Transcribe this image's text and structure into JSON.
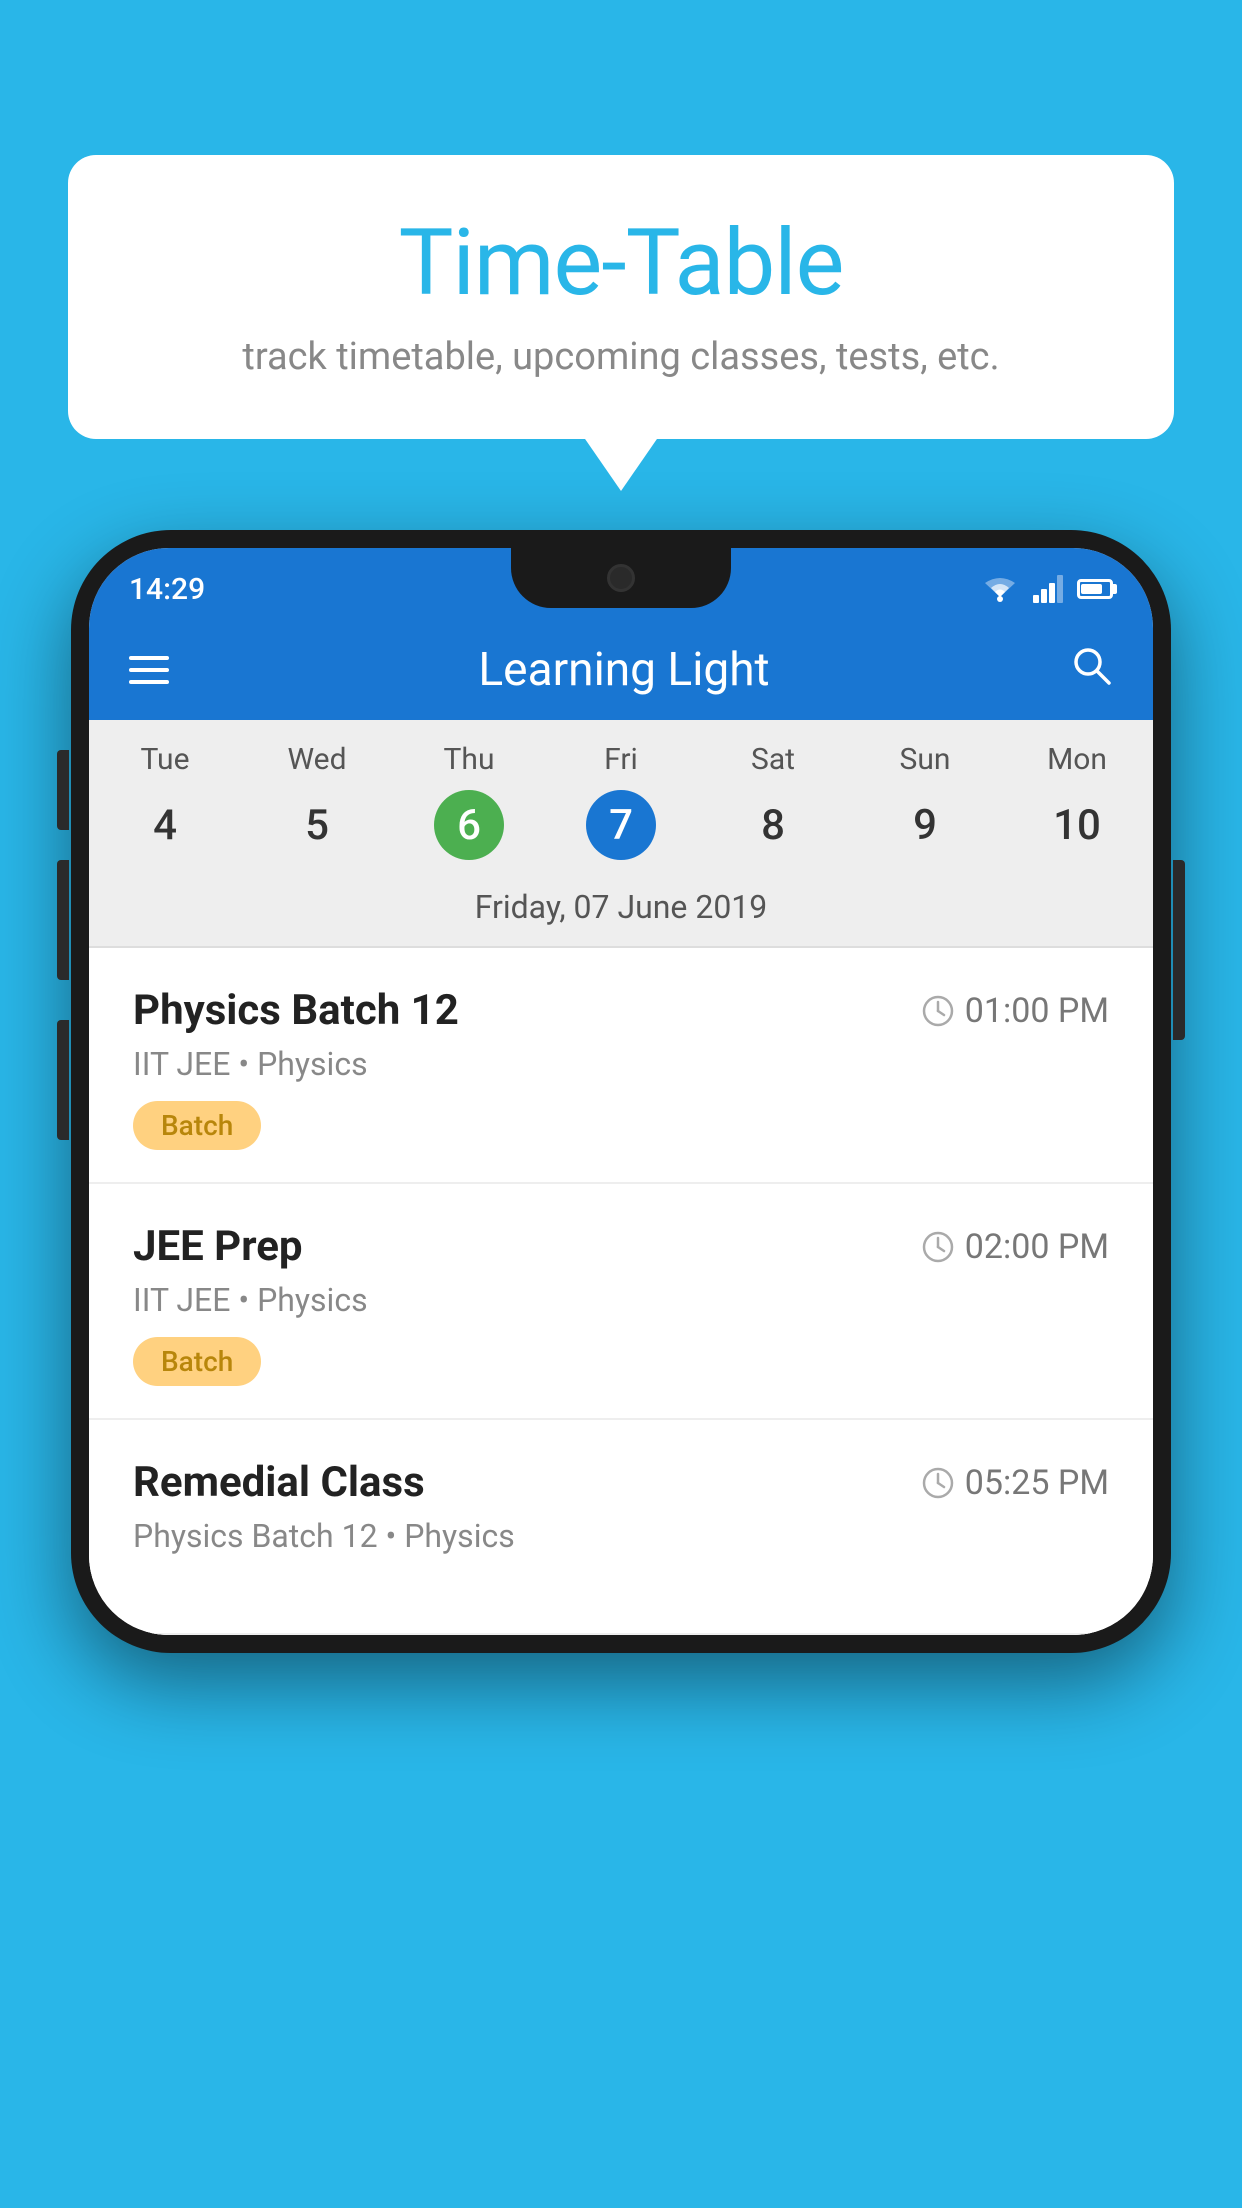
{
  "background_color": "#29b6e8",
  "speech_bubble": {
    "title": "Time-Table",
    "subtitle": "track timetable, upcoming classes, tests, etc."
  },
  "status_bar": {
    "time": "14:29"
  },
  "app_bar": {
    "title": "Learning Light",
    "search_placeholder": "Search"
  },
  "calendar": {
    "days_of_week": [
      "Tue",
      "Wed",
      "Thu",
      "Fri",
      "Sat",
      "Sun",
      "Mon"
    ],
    "dates": [
      "4",
      "5",
      "6",
      "7",
      "8",
      "9",
      "10"
    ],
    "today_index": 2,
    "selected_index": 3,
    "selected_date_label": "Friday, 07 June 2019"
  },
  "schedule_items": [
    {
      "title": "Physics Batch 12",
      "time": "01:00 PM",
      "subtitle": "IIT JEE • Physics",
      "badge": "Batch"
    },
    {
      "title": "JEE Prep",
      "time": "02:00 PM",
      "subtitle": "IIT JEE • Physics",
      "badge": "Batch"
    },
    {
      "title": "Remedial Class",
      "time": "05:25 PM",
      "subtitle": "Physics Batch 12 • Physics",
      "badge": ""
    }
  ],
  "icons": {
    "hamburger": "☰",
    "search": "🔍",
    "clock": "🕐"
  }
}
